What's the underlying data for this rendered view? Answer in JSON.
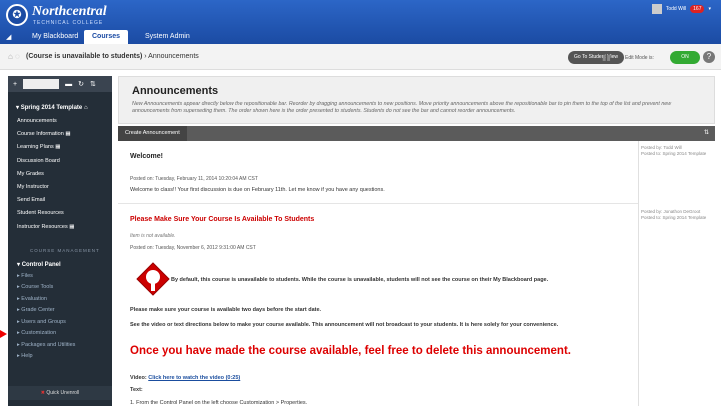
{
  "header": {
    "logo_icon": "seal-icon",
    "logo_name": "Northcentral",
    "logo_sub": "TECHNICAL COLLEGE",
    "tabs": [
      "My Blackboard",
      "Courses",
      "System Admin"
    ],
    "user_name": "Todd Will",
    "badge_count": "167"
  },
  "breadcrumb": {
    "course": "(Course is unavailable to students)",
    "separator": "›",
    "page": "Announcements"
  },
  "controls": {
    "student_view": "Go To Student View",
    "edit_mode_label": "Edit Mode is:",
    "edit_mode_value": "ON",
    "help": "?"
  },
  "sidebar": {
    "course_title": "Spring 2014 Template",
    "items": [
      "Announcements",
      "Course Information",
      "Learning Plans",
      "Discussion Board",
      "My Grades",
      "My Instructor",
      "Send Email",
      "Student Resources",
      "Instructor Resources"
    ],
    "management_header": "COURSE MANAGEMENT",
    "control_panel": "Control Panel",
    "cp_items": [
      "Files",
      "Course Tools",
      "Evaluation",
      "Grade Center",
      "Users and Groups",
      "Customization",
      "Packages and Utilities",
      "Help"
    ],
    "quick_unenroll": "Quick Unenroll"
  },
  "main": {
    "title": "Announcements",
    "description": "New Announcements appear directly below the repositionable bar. Reorder by dragging announcements to new positions. Move priority announcements above the repositionable bar to pin them to the top of the list and prevent new announcements from superseding them. The order shown here is the order presented to students. Students do not see the bar and cannot reorder announcements.",
    "create_button": "Create Announcement"
  },
  "posts": [
    {
      "title": "Welcome!",
      "posted_on": "Posted on: Tuesday, February 11, 2014 10:20:04 AM CST",
      "body": "Welcome to class!! Your first discussion is due on February 11th. Let me know if you have any questions.",
      "posted_by": "Posted by: Todd Will",
      "posted_to": "Posted to: Spring 2014 Template"
    },
    {
      "title": "Please Make Sure Your Course Is Available To Students",
      "not_available": "Item is not available.",
      "posted_on": "Posted on: Tuesday, November 6, 2012 9:31:00 AM CST",
      "default_text": "By default, this course is unavailable to students. While the course is unavailable, students will not see the course on their My Blackboard page.",
      "two_days": "Please make sure your course is available two days before the start date.",
      "see_video": "See the video or text directions below to make your course available.   This announcement will not broadcast to your students.  It is here solely for your convenience.",
      "big_text": "Once you have made the course available, feel free to delete this announcement.",
      "video_label": "Video:",
      "video_link": "Click here to watch the video (0:25)",
      "text_label": "Text:",
      "step1": "1. From the Control Panel on the left choose Customization > Properties.",
      "posted_by": "Posted by: Jonathon DeGroot",
      "posted_to": "Posted to: Spring 2014 Template"
    }
  ],
  "colors": {
    "topbar": "#1b4ba3",
    "sidebar": "#242e38",
    "accent_red": "#cc0000",
    "toggle_on": "#33aa33"
  }
}
